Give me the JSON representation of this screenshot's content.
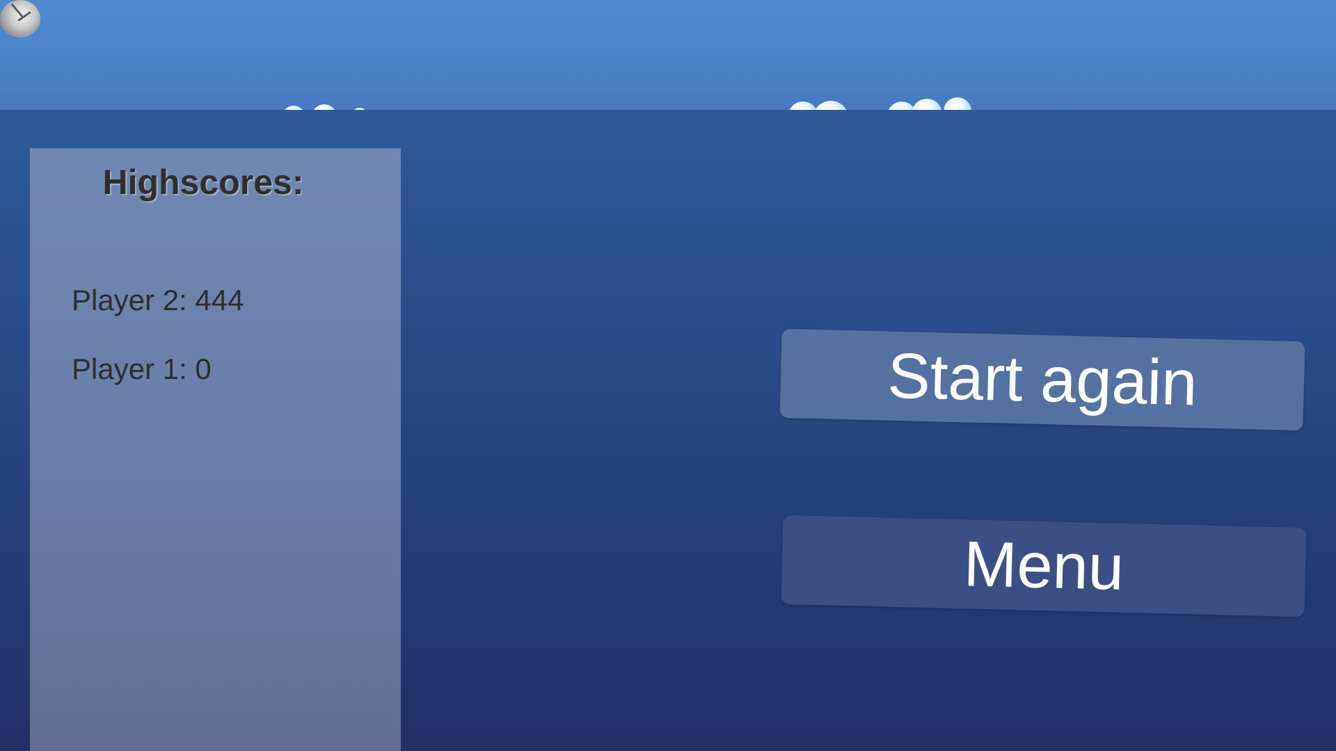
{
  "highscores": {
    "title": "Highscores:",
    "entries": [
      {
        "text": "Player 2: 444"
      },
      {
        "text": "Player 1: 0"
      }
    ]
  },
  "buttons": {
    "start_again_label": "Start again",
    "menu_label": "Menu"
  },
  "colors": {
    "sky": "#4f8bd0",
    "overlay": "#2a4d8d",
    "panel": "#6d83ad",
    "start_button": "#5670a2",
    "menu_button": "#3d4e85",
    "text_dark": "#2e2e2e",
    "text_light": "#ffffff"
  }
}
